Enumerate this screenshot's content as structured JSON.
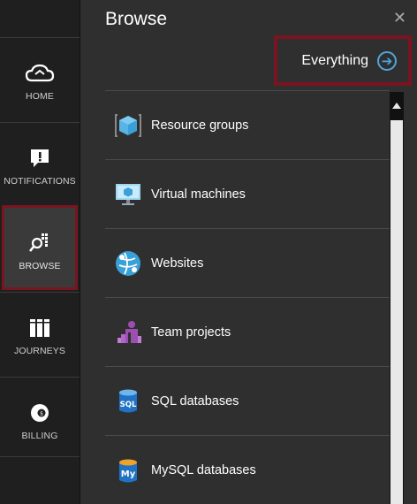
{
  "nav": {
    "items": [
      {
        "label": "HOME",
        "icon": "cloud-icon"
      },
      {
        "label": "NOTIFICATIONS",
        "icon": "notification-icon"
      },
      {
        "label": "BROWSE",
        "icon": "browse-icon",
        "active": true
      },
      {
        "label": "JOURNEYS",
        "icon": "journeys-icon"
      },
      {
        "label": "BILLING",
        "icon": "billing-icon"
      }
    ]
  },
  "panel": {
    "title": "Browse",
    "close_glyph": "✕",
    "everything_label": "Everything",
    "arrow_glyph": "➔",
    "items": [
      {
        "label": "Resource groups",
        "icon": "resource-groups-icon"
      },
      {
        "label": "Virtual machines",
        "icon": "virtual-machine-icon"
      },
      {
        "label": "Websites",
        "icon": "websites-icon"
      },
      {
        "label": "Team projects",
        "icon": "team-projects-icon"
      },
      {
        "label": "SQL databases",
        "icon": "sql-database-icon"
      },
      {
        "label": "MySQL databases",
        "icon": "mysql-database-icon"
      }
    ]
  },
  "colors": {
    "highlight_border": "#7a1420",
    "accent_blue": "#4fa5dd"
  }
}
